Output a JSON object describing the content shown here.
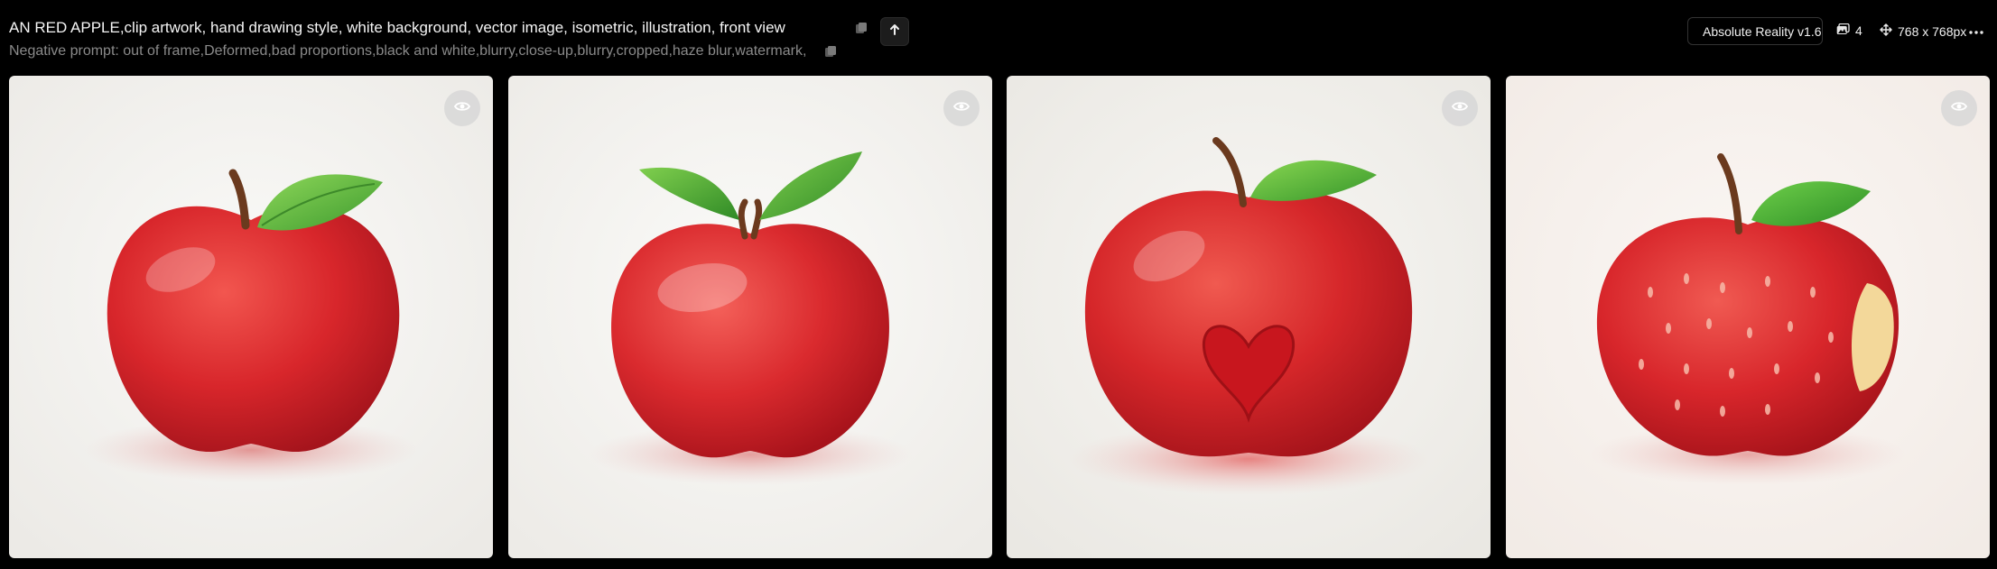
{
  "header": {
    "prompt": "AN RED APPLE,clip artwork, hand drawing style, white background, vector image, isometric, illustration, front view",
    "negative_prompt": "Negative prompt: out of frame,Deformed,bad proportions,black and white,blurry,close-up,blurry,cropped,haze blur,watermark,",
    "model_name": "Absolute Reality v1.6",
    "image_count": "4",
    "dimensions": "768 x 768px"
  },
  "icons": {
    "copy": "copy-icon",
    "upload": "arrow-up-icon",
    "images": "images-icon",
    "dimensions": "move-icon",
    "more": "more-horizontal-icon",
    "preview": "eye-icon"
  },
  "images": [
    {
      "alt": "Red apple with single leaf, front view"
    },
    {
      "alt": "Red apple with two leaves, front view"
    },
    {
      "alt": "Red apple with heart shape, front view"
    },
    {
      "alt": "Red apple with speckles and bite mark, front view"
    }
  ],
  "colors": {
    "background": "#000000",
    "card_background": "#f3f2f0",
    "apple_red": "#d8262b",
    "leaf_green": "#4caf3a"
  }
}
